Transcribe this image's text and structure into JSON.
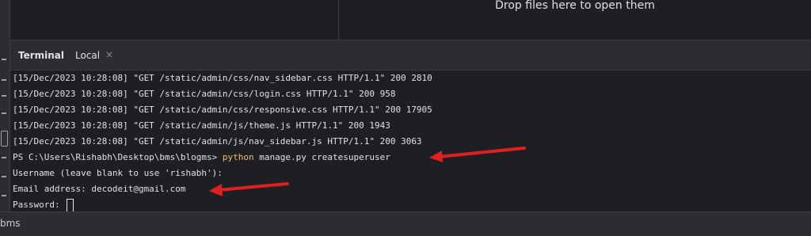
{
  "editor": {
    "drop_hint": "Drop files here to open them"
  },
  "terminal": {
    "tabs": [
      {
        "label": "Terminal",
        "active": true
      },
      {
        "label": "Local",
        "close_icon": "×"
      }
    ],
    "lines": [
      "[15/Dec/2023 10:28:08] \"GET /static/admin/css/nav_sidebar.css HTTP/1.1\" 200 2810",
      "[15/Dec/2023 10:28:08] \"GET /static/admin/css/login.css HTTP/1.1\" 200 958",
      "[15/Dec/2023 10:28:08] \"GET /static/admin/css/responsive.css HTTP/1.1\" 200 17905",
      "[15/Dec/2023 10:28:08] \"GET /static/admin/js/theme.js HTTP/1.1\" 200 1943",
      "[15/Dec/2023 10:28:08] \"GET /static/admin/js/nav_sidebar.js HTTP/1.1\" 200 3063"
    ],
    "prompt": {
      "path": "PS C:\\Users\\Rishabh\\Desktop\\bms\\blogms> ",
      "command": "python",
      "args": " manage.py createsuperuser"
    },
    "username_line": "Username (leave blank to use 'rishabh'):",
    "email_line": "Email address: decodeit@gmail.com",
    "password_line": "Password: "
  },
  "status_bar": {
    "text": "bms"
  },
  "colors": {
    "background": "#1e1f22",
    "panel": "#2b2d30",
    "command_highlight": "#e5c07b",
    "annotation_arrow": "#e02020"
  }
}
